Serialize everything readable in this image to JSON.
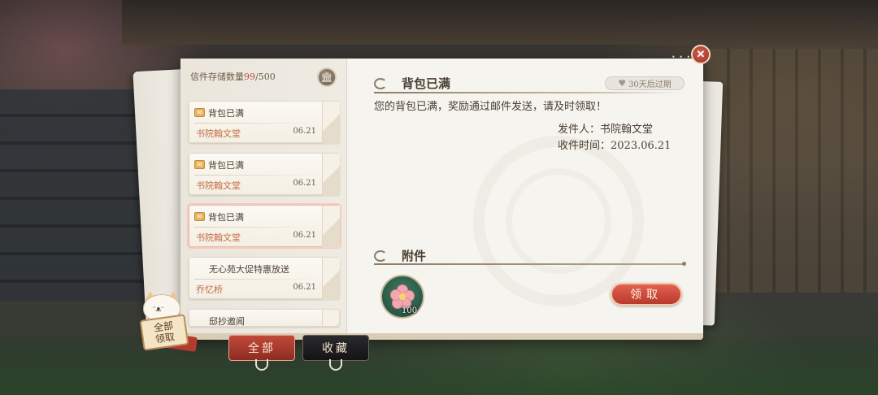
{
  "storage": {
    "label": "信件存储数量",
    "count": "99",
    "max": "/500"
  },
  "mails": [
    {
      "title": "背包已满",
      "sender": "书院翰文堂",
      "date": "06.21",
      "has_icon": true
    },
    {
      "title": "背包已满",
      "sender": "书院翰文堂",
      "date": "06.21",
      "has_icon": true
    },
    {
      "title": "背包已满",
      "sender": "书院翰文堂",
      "date": "06.21",
      "has_icon": true,
      "selected": true
    },
    {
      "title": "无心苑大促特惠放送",
      "sender": "乔忆桥",
      "date": "06.21",
      "has_icon": false
    },
    {
      "title": "邸抄邀闻",
      "sender": "",
      "date": "",
      "has_icon": false
    }
  ],
  "detail": {
    "title": "背包已满",
    "expire": "30天后过期",
    "body": "您的背包已满，奖励通过邮件发送，请及时领取！",
    "sender_line": "发件人：书院翰文堂",
    "time_line": "收件时间：2023.06.21",
    "attachment_label": "附件",
    "attachment_qty": "100",
    "claim_label": "领取"
  },
  "tabs": {
    "all": "全部",
    "favorites": "收藏"
  },
  "claim_all": {
    "line1": "全部",
    "line2": "领取"
  },
  "close": {
    "glyph": "✕"
  },
  "colors": {
    "accent_red": "#b83a2d",
    "paper": "#f6f4ef",
    "sender_orange": "#c36b3f",
    "count_red": "#b94a3c"
  }
}
